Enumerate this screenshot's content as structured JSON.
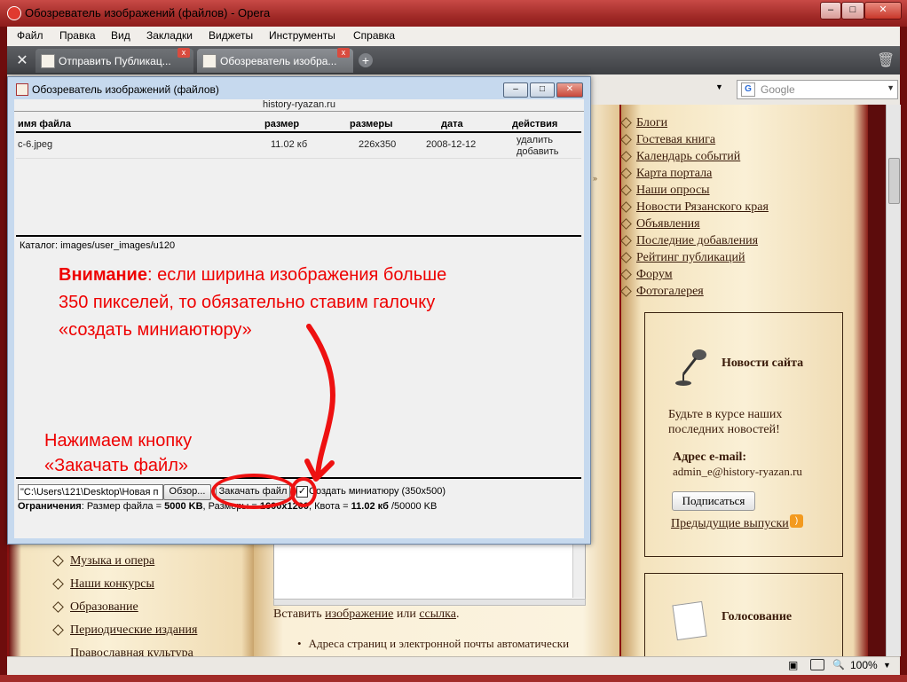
{
  "window": {
    "title": "Обозреватель изображений (файлов) - Opera",
    "controls": [
      "–",
      "□",
      "✕"
    ]
  },
  "menu": [
    "Файл",
    "Правка",
    "Вид",
    "Закладки",
    "Виджеты",
    "Инструменты",
    "Справка"
  ],
  "tabs": [
    {
      "label": "Отправить Публикац..."
    },
    {
      "label": "Обозреватель изобра..."
    }
  ],
  "search": {
    "placeholder": "Google",
    "engine_badge": "G"
  },
  "popup": {
    "title": "Обозреватель изображений (файлов)",
    "site": "history-ryazan.ru",
    "columns": {
      "name": "имя файла",
      "size": "размер",
      "dims": "размеры",
      "date": "дата",
      "actions": "действия"
    },
    "files": [
      {
        "name": "c-6.jpeg",
        "size": "11.02 кб",
        "dims": "226x350",
        "date": "2008-12-12",
        "delete": "удалить",
        "add": "добавить"
      }
    ],
    "catalog": "Каталог: images/user_images/u120",
    "file_path": "\"C:\\Users\\121\\Desktop\\Новая п",
    "browse_label": "Обзор...",
    "upload_label": "Закачать файл",
    "checkbox_mark": "✓",
    "thumbnail_label": "Создать миниатюру (350x500)",
    "limits": {
      "prefix": "Ограничения",
      "size_text": ": Размер файла = ",
      "size_value": "5000 KB",
      "dims_text": ", Размеры = ",
      "dims_value": "1600x1200",
      "quota_text": ", Квота = ",
      "quota_value": "11.02 кб",
      "quota_total": " /50000 KB"
    }
  },
  "annotations": {
    "warning_bold": "Внимание",
    "warning_line1": ": если ширина изображения больше",
    "warning_line2": "350 пикселей, то обязательно ставим галочку",
    "warning_line3": "«создать миниаютюру»",
    "press_line1": "Нажимаем кнопку",
    "press_line2": "«Закачать файл»",
    "color": "#e00000"
  },
  "right_menu": [
    "Блоги",
    "Гостевая книга",
    "Календарь событий",
    "Карта портала",
    "Наши опросы",
    "Новости Рязанского края",
    "Объявления",
    "Последние добавления",
    "Рейтинг публикаций",
    "Форум",
    "Фотогалерея"
  ],
  "news": {
    "title": "Новости сайта",
    "text1": "Будьте в курсе наших",
    "text2": "последних новостей!",
    "email_label": "Адрес e-mail:",
    "email": "admin_e@history-ryazan.ru",
    "subscribe": "Подписаться",
    "previous": "Предыдущие выпуски"
  },
  "poll": {
    "title": "Голосование"
  },
  "left_menu": [
    "Музыка и опера",
    "Наши конкурсы",
    "Образование",
    "Периодические издания",
    "Православная культура"
  ],
  "editor": {
    "insert_prefix": "Вставить ",
    "insert_image": "изображение",
    "insert_or": " или ",
    "insert_link": "ссылка",
    "insert_suffix": ".",
    "note": "Адреса страниц и электронной почты автоматически"
  },
  "status": {
    "zoom": "100%"
  }
}
